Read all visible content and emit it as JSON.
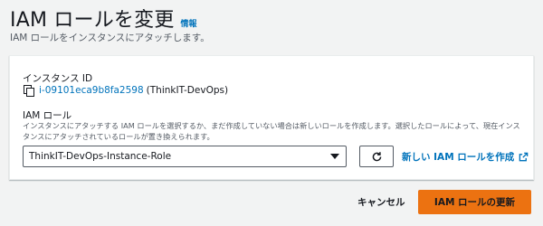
{
  "header": {
    "title": "IAM ロールを変更",
    "info_link": "情報"
  },
  "subtitle": "IAM ロールをインスタンスにアタッチします。",
  "instance": {
    "label": "インスタンス ID",
    "id": "i-09101eca9b8fa2598",
    "name": "(ThinkIT-DevOps)"
  },
  "iam_role": {
    "label": "IAM ロール",
    "description": "インスタンスにアタッチする IAM ロールを選択するか、まだ作成していない場合は新しいロールを作成します。選択したロールによって、現在インスタンスにアタッチされているロールが置き換えられます。",
    "selected": "ThinkIT-DevOps-Instance-Role",
    "create_link": "新しい IAM ロールを作成"
  },
  "footer": {
    "cancel_label": "キャンセル",
    "update_label": "IAM ロールの更新"
  },
  "colors": {
    "accent": "#ec7211",
    "link": "#0073bb",
    "background": "#f2f3f3"
  },
  "icons": [
    "copy-icon",
    "caret-down-icon",
    "refresh-icon",
    "external-link-icon"
  ]
}
